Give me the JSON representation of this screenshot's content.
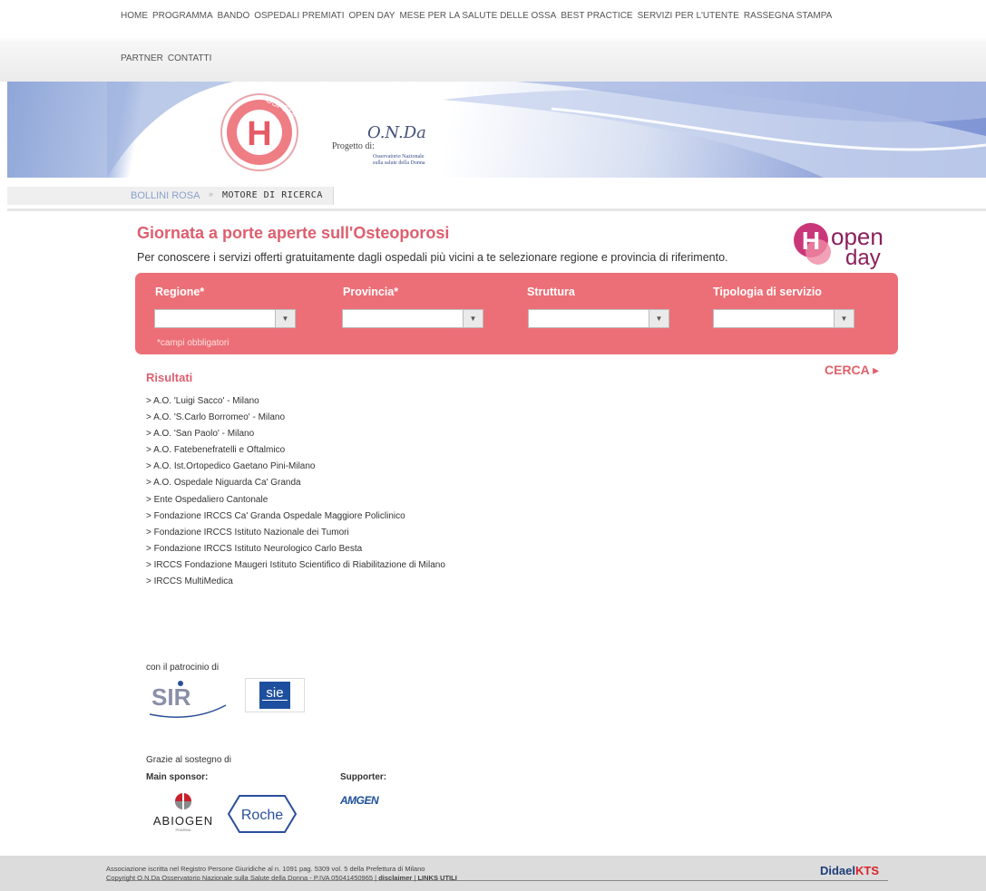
{
  "nav": {
    "row1": [
      "HOME",
      "PROGRAMMA",
      "BANDO",
      "OSPEDALI PREMIATI",
      "OPEN DAY",
      "MESE PER LA SALUTE DELLE OSSA",
      "BEST PRACTICE",
      "SERVIZI PER L'UTENTE",
      "RASSEGNA STAMPA"
    ],
    "row2": [
      "PARTNER",
      "CONTATTI"
    ]
  },
  "banner": {
    "logo_text": "OSPEDALE DONNA",
    "logo_letter": "H",
    "progetto": "Progetto di:",
    "signature": "O.N.Da",
    "onda_line1": "Osservatorio Nazionale",
    "onda_line2": "sulla salute della Donna"
  },
  "breadcrumb": {
    "first": "BOLLINI ROSA",
    "separator": "»",
    "second": "MOTORE DI RICERCA"
  },
  "page": {
    "title": "Giornata a porte aperte sull'Osteoporosi",
    "subtitle": "Per conoscere i servizi offerti gratuitamente dagli ospedali più vicini a te selezionare regione e provincia di riferimento."
  },
  "openday_logo": {
    "letter": "H",
    "word1": "open",
    "word2": "day"
  },
  "search": {
    "regione_label": "Regione*",
    "provincia_label": "Provincia*",
    "struttura_label": "Struttura",
    "tipologia_label": "Tipologia di servizio",
    "regione_value": "",
    "provincia_value": "",
    "struttura_value": "",
    "tipologia_value": "",
    "required_note": "*campi obbligatori",
    "cerca_label": "CERCA ▸"
  },
  "results": {
    "title": "Risultati",
    "items": [
      "> A.O. 'Luigi Sacco' - Milano",
      "> A.O. 'S.Carlo Borromeo' - Milano",
      "> A.O. 'San Paolo' - Milano",
      "> A.O. Fatebenefratelli e Oftalmico",
      "> A.O. Ist.Ortopedico Gaetano Pini-Milano",
      "> A.O. Ospedale Niguarda Ca' Granda",
      "> Ente Ospedaliero Cantonale",
      "> Fondazione IRCCS Ca' Granda Ospedale Maggiore Policlinico",
      "> Fondazione IRCCS Istituto Nazionale dei Tumori",
      "> Fondazione IRCCS Istituto Neurologico Carlo Besta",
      "> IRCCS Fondazione Maugeri Istituto Scientifico di Riabilitazione di Milano",
      "> IRCCS MultiMedica"
    ]
  },
  "patronage": {
    "label": "con il patrocinio di",
    "sir_text": "SIR",
    "sie_text": "sie"
  },
  "sponsors": {
    "thanks": "Grazie al sostegno di",
    "main_label": "Main sponsor:",
    "supporter_label": "Supporter:",
    "abiogen": "ABIOGEN",
    "abiogen_sub": "PHARMA",
    "roche": "Roche",
    "amgen": "AMGEN"
  },
  "footer": {
    "line1": "Associazione iscritta nel Registro Persone Giuridiche al n. 1091 pag. 5309 vol. 5 della Prefettura di Milano",
    "line2_prefix": "Copyright O.N.Da Osservatorio Nazionale sulla Salute della Donna - P.IVA 05041450965 |",
    "disclaimer": "disclaimer",
    "divider": "|",
    "links": "LINKS UTILI",
    "brand1": "Didael",
    "brand2": "KTS"
  },
  "colors": {
    "accent": "#ec6f77",
    "title": "#dd5f6f",
    "breadcrumb": "#8aa0cc"
  }
}
